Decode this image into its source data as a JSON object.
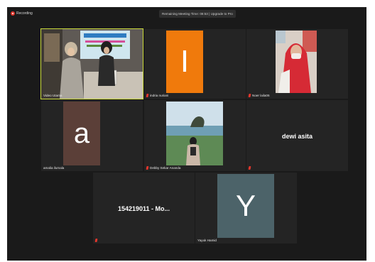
{
  "topbar": {
    "recording_label": "Recording",
    "meeting_timer": "Remaining Meeting Time: 08:53 | Upgrade to Pro"
  },
  "participants": [
    {
      "name": "Video Utama",
      "avatar_letter": "",
      "display_text": "",
      "tile_color": "#2b2b2b",
      "active_speaker": true
    },
    {
      "name": "indria nuriani",
      "avatar_letter": "I",
      "display_text": "",
      "tile_color": "#f07a0c"
    },
    {
      "name": "Noer laila06",
      "avatar_letter": "",
      "display_text": ""
    },
    {
      "name": "amalia ilumala",
      "avatar_letter": "a",
      "display_text": "",
      "tile_color": "#5b3f38"
    },
    {
      "name": "Debby Sekar Ananda",
      "avatar_letter": "",
      "display_text": ""
    },
    {
      "name": "",
      "avatar_letter": "",
      "display_text": "dewi asita"
    },
    {
      "name": "",
      "avatar_letter": "",
      "display_text": "154219011 - Mo..."
    },
    {
      "name": "Yayuk Hamid",
      "avatar_letter": "Y",
      "display_text": "",
      "tile_color": "#4c6369"
    }
  ],
  "colors": {
    "mic_muted": "#e0362c",
    "active_border": "#c9d93a",
    "background": "#1a1a1a"
  }
}
